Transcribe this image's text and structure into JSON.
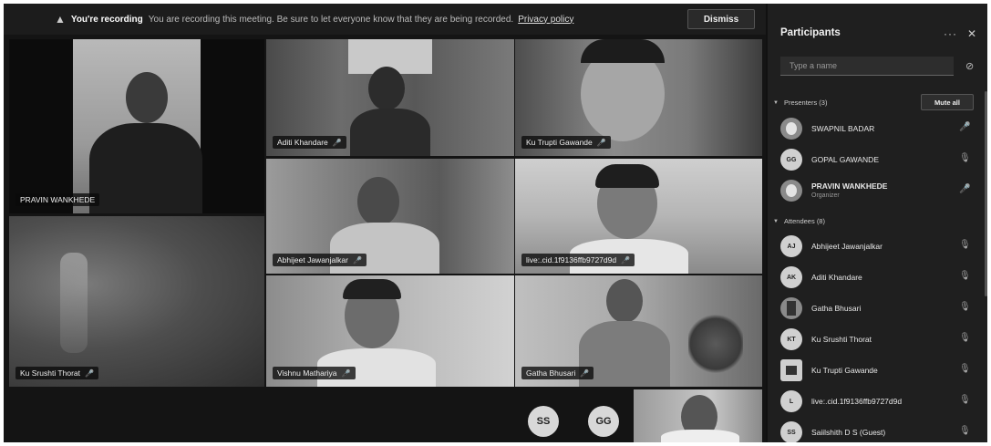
{
  "banner": {
    "warning_icon": "▲",
    "title": "You're recording",
    "message": "You are recording this meeting. Be sure to let everyone know that they are being recorded.",
    "link": "Privacy policy",
    "dismiss_label": "Dismiss"
  },
  "tiles": [
    {
      "name": "PRAVIN WANKHEDE"
    },
    {
      "name": "Aditi Khandare"
    },
    {
      "name": "Ku Trupti Gawande"
    },
    {
      "name": "Abhijeet Jawanjalkar"
    },
    {
      "name": "live:.cid.1f9136ffb9727d9d"
    },
    {
      "name": "Ku Srushti Thorat"
    },
    {
      "name": "Vishnu Mathariya"
    },
    {
      "name": "Gatha Bhusari"
    }
  ],
  "overflow_avatars": [
    "SS",
    "GG"
  ],
  "panel": {
    "title": "Participants",
    "more_icon": "···",
    "close_icon": "✕",
    "search_placeholder": "Type a name",
    "share_icon": "⊘",
    "presenters_label": "Presenters (3)",
    "mute_all_label": "Mute all",
    "attendees_label": "Attendees (8)",
    "presenters": [
      {
        "initials": "",
        "name": "SWAPNIL BADAR",
        "role": "",
        "muted": false
      },
      {
        "initials": "GG",
        "name": "GOPAL GAWANDE",
        "role": "",
        "muted": true
      },
      {
        "initials": "",
        "name": "PRAVIN WANKHEDE",
        "role": "Organizer",
        "muted": false
      }
    ],
    "attendees": [
      {
        "initials": "AJ",
        "name": "Abhijeet Jawanjalkar",
        "muted": true
      },
      {
        "initials": "AK",
        "name": "Aditi Khandare",
        "muted": true
      },
      {
        "initials": "",
        "name": "Gatha Bhusari",
        "muted": true
      },
      {
        "initials": "KT",
        "name": "Ku Srushti Thorat",
        "muted": true
      },
      {
        "initials": "",
        "name": "Ku Trupti Gawande",
        "muted": true
      },
      {
        "initials": "L",
        "name": "live:.cid.1f9136ffb9727d9d",
        "muted": true
      },
      {
        "initials": "SS",
        "name": "Saiilshith D S (Guest)",
        "muted": true
      }
    ]
  }
}
